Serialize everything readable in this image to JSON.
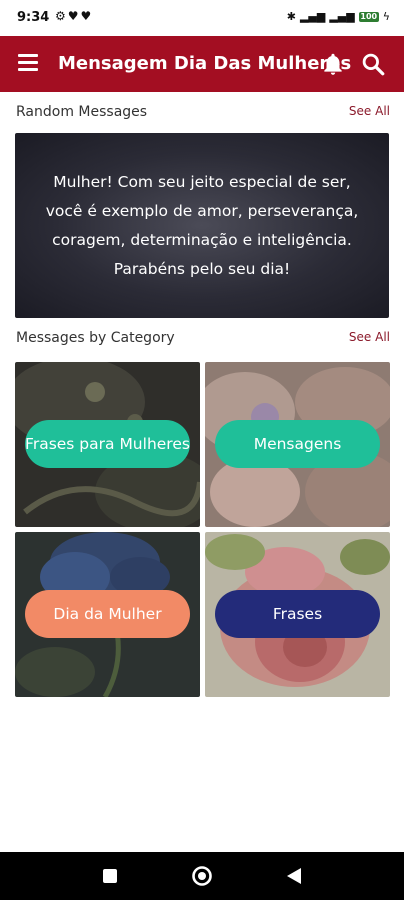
{
  "status_bar": {
    "time": "9:34",
    "battery": "100"
  },
  "app_bar": {
    "title": "Mensagem Dia Das Mulheres"
  },
  "random_section": {
    "label": "Random Messages",
    "see_all": "See All"
  },
  "random_message": {
    "lines": [
      "Mulher! Com seu jeito especial de ser,",
      "você é exemplo de amor, perseverança,",
      "coragem, determinação e inteligência.",
      "Parabéns pelo seu dia!"
    ]
  },
  "category_section": {
    "label": "Messages by Category",
    "see_all": "See All"
  },
  "categories": [
    {
      "label": "Frases para Mulheres",
      "color": "#1fbf99"
    },
    {
      "label": "Mensagens",
      "color": "#1fbf99"
    },
    {
      "label": "Dia da Mulher",
      "color": "#f28a66"
    },
    {
      "label": "Frases",
      "color": "#232b7a"
    }
  ],
  "colors": {
    "app_bar": "#a30e22",
    "see_all": "#8b1a2b"
  }
}
